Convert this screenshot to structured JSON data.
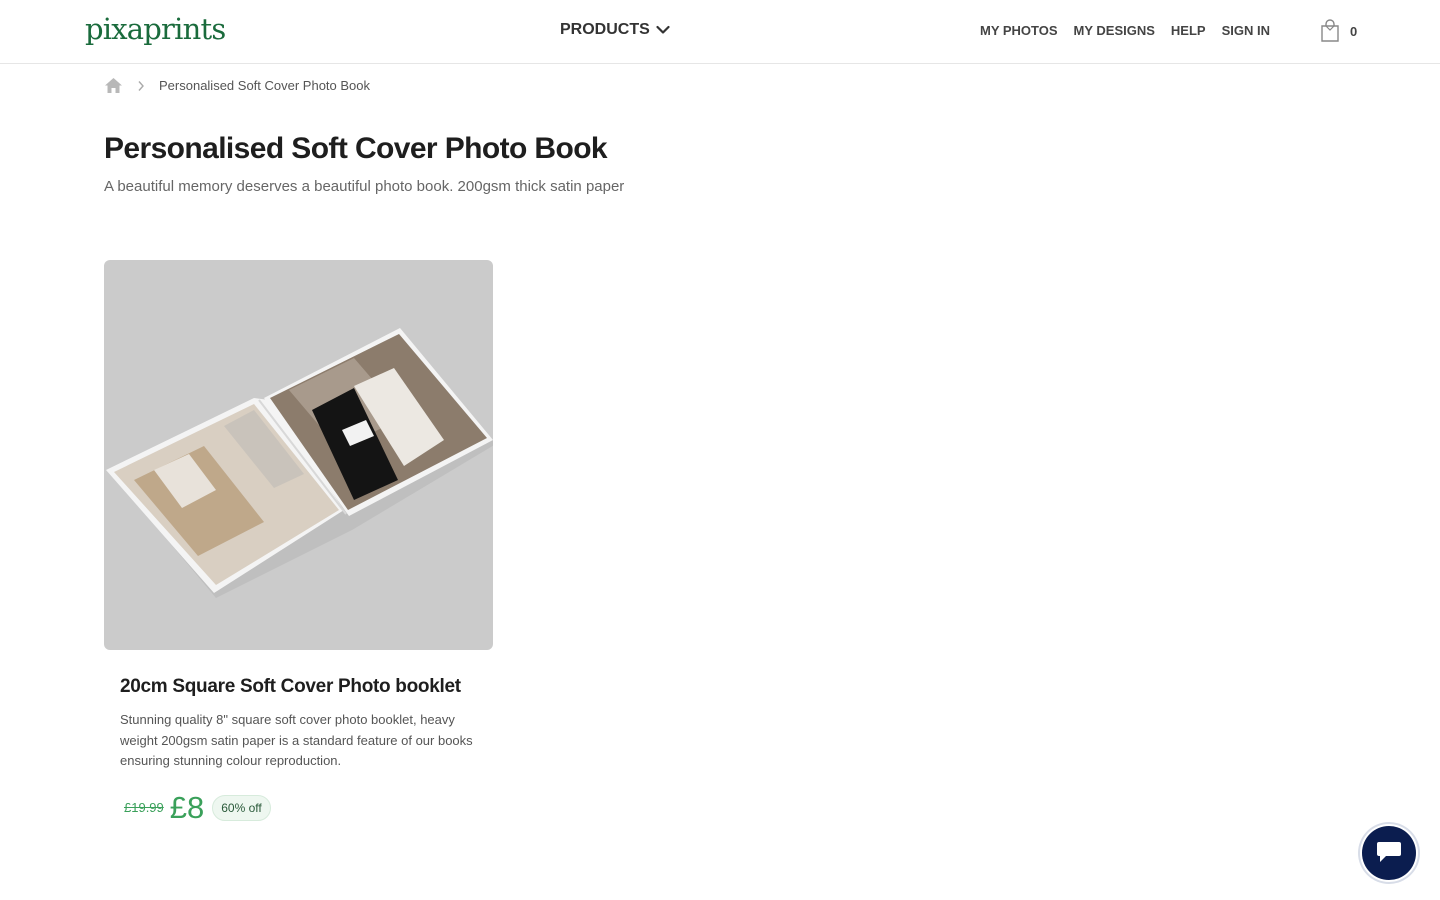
{
  "brand": {
    "logo_text": "pixaprints",
    "color": "#1a6b3c"
  },
  "header": {
    "products_label": "PRODUCTS",
    "nav": [
      "MY PHOTOS",
      "MY DESIGNS",
      "HELP",
      "SIGN IN"
    ],
    "cart_count": "0"
  },
  "breadcrumb": {
    "current": "Personalised Soft Cover Photo Book"
  },
  "page": {
    "title": "Personalised Soft Cover Photo Book",
    "subtitle": "A beautiful memory deserves a beautiful photo book.  200gsm thick satin paper"
  },
  "products": [
    {
      "title": "20cm Square Soft Cover Photo booklet",
      "description": "Stunning quality 8\" square soft cover photo booklet, heavy weight 200gsm satin paper is a standard feature of our books ensuring stunning colour reproduction.",
      "old_price": "£19.99",
      "price": "£8",
      "discount": "60% off"
    }
  ],
  "colors": {
    "accent": "#3aa05a",
    "chat": "#0b1d4f"
  }
}
